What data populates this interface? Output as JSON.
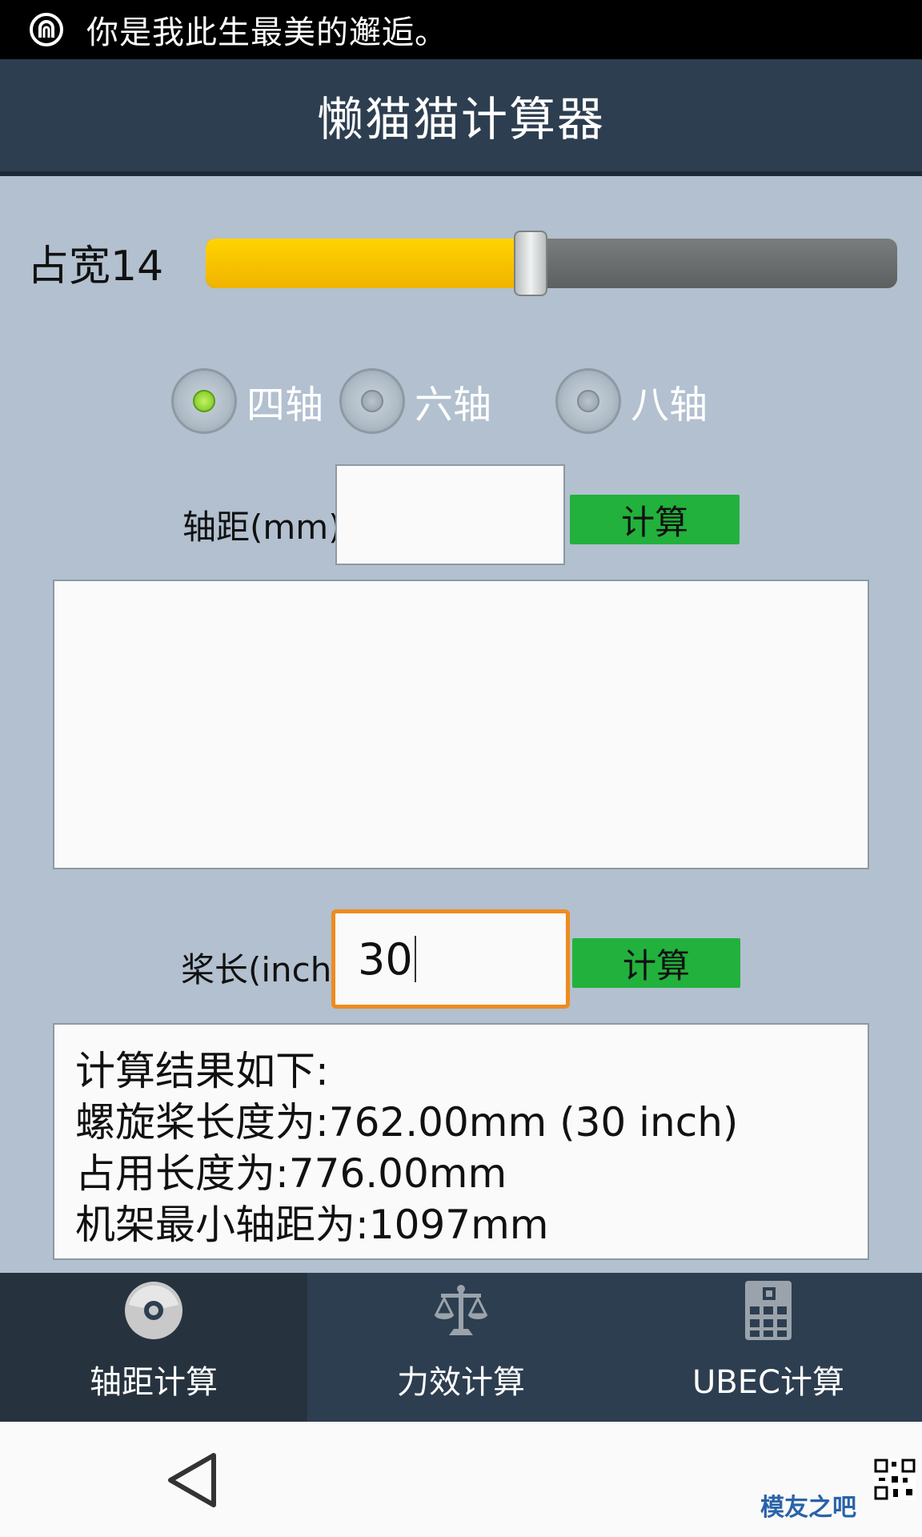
{
  "status_bar": {
    "text": "你是我此生最美的邂逅。"
  },
  "title": "懒猫猫计算器",
  "slider": {
    "label": "占宽14",
    "value_fraction": 0.47
  },
  "radios": [
    {
      "label": "四轴",
      "checked": true
    },
    {
      "label": "六轴",
      "checked": false
    },
    {
      "label": "八轴",
      "checked": false
    }
  ],
  "wheelbase": {
    "label": "轴距(mm)",
    "value": "",
    "button": "计算"
  },
  "prop": {
    "label": "桨长(inch)",
    "value": "30",
    "button": "计算"
  },
  "result": {
    "lines": [
      "计算结果如下:",
      "螺旋桨长度为:762.00mm (30 inch)",
      "占用长度为:776.00mm",
      "机架最小轴距为:1097mm"
    ]
  },
  "bottom_nav": [
    {
      "label": "轴距计算",
      "icon": "disc-icon",
      "active": true
    },
    {
      "label": "力效计算",
      "icon": "scale-icon",
      "active": false
    },
    {
      "label": "UBEC计算",
      "icon": "calculator-icon",
      "active": false
    }
  ],
  "watermark": "模友之吧",
  "colors": {
    "background": "#b2c0cf",
    "header": "#2d3e50",
    "accent_button": "#22b13c",
    "slider_fill": "#ffd400",
    "focus_border": "#ef8b1e"
  }
}
